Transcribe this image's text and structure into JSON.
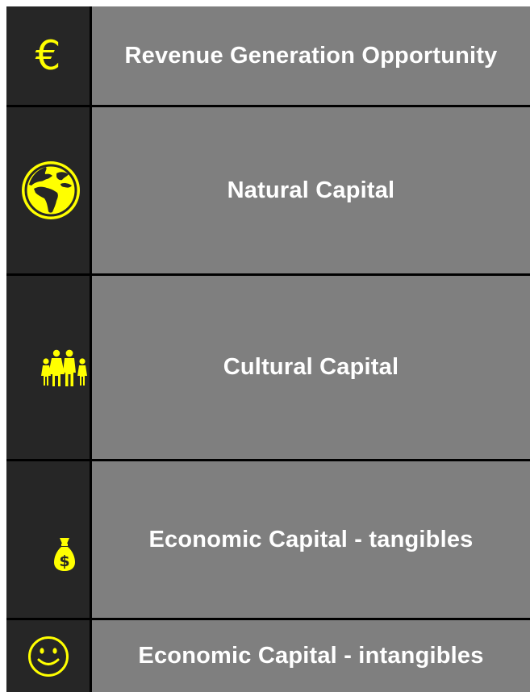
{
  "colors": {
    "accent": "#ffff00",
    "icon_column": "#262626",
    "label_background": "#7f7f7f",
    "grid_lines": "#000000",
    "label_text": "#ffffff"
  },
  "rows": [
    {
      "icon": "euro-icon",
      "icon_glyph": "€",
      "label": "Revenue Generation Opportunity"
    },
    {
      "icon": "globe-icon",
      "label": "Natural Capital"
    },
    {
      "icon": "family-icon",
      "label": "Cultural Capital"
    },
    {
      "icon": "money-bag-icon",
      "label": "Economic Capital - tangibles"
    },
    {
      "icon": "smiley-icon",
      "label": "Economic Capital - intangibles"
    }
  ]
}
